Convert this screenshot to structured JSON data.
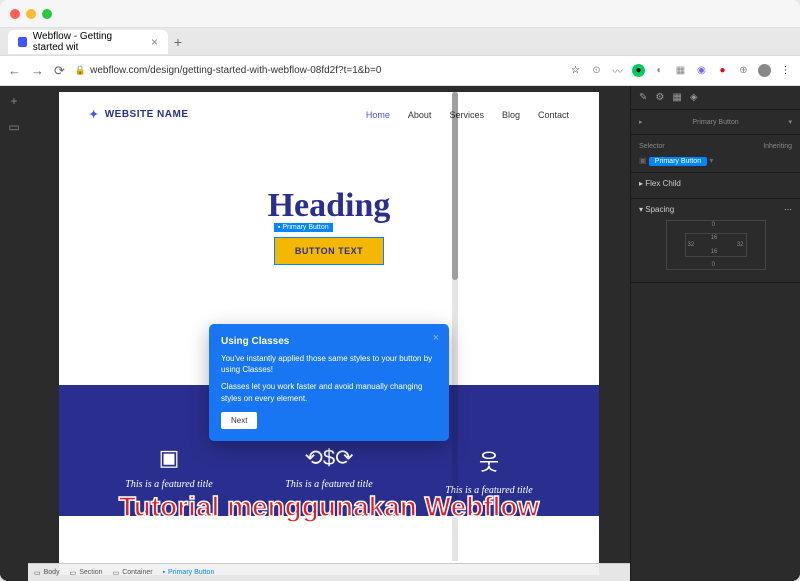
{
  "browser": {
    "tab_title": "Webflow - Getting started wit",
    "url": "webflow.com/design/getting-started-with-webflow-08fd2f?t=1&b=0"
  },
  "site": {
    "brand": "WEBSITE NAME",
    "nav": [
      "Home",
      "About",
      "Services",
      "Blog",
      "Contact"
    ],
    "hero_heading": "Heading",
    "button_tag": "Primary Button",
    "button_text": "BUTTON TEXT",
    "features": [
      {
        "title": "This is a featured title"
      },
      {
        "title": "This is a featured title"
      },
      {
        "title": "This is a featured title"
      }
    ]
  },
  "tooltip": {
    "title": "Using Classes",
    "body1": "You've instantly applied those same styles to your button by using Classes!",
    "body2": "Classes let you work faster and avoid manually changing styles on every element.",
    "next": "Next"
  },
  "panel": {
    "element": "Primary Button",
    "selector_label": "Selector",
    "inherit_label": "Inheriting",
    "badge": "Primary Button",
    "layout_label": "Flex Child",
    "spacing_label": "Spacing",
    "vals": {
      "t": "16",
      "r": "32",
      "b": "16",
      "l": "32",
      "mt": "0",
      "mb": "0"
    }
  },
  "breadcrumb": {
    "body": "Body",
    "section": "Section",
    "container": "Container",
    "button": "Primary Button"
  },
  "overlay": "Tutorial menggunakan Webflow"
}
